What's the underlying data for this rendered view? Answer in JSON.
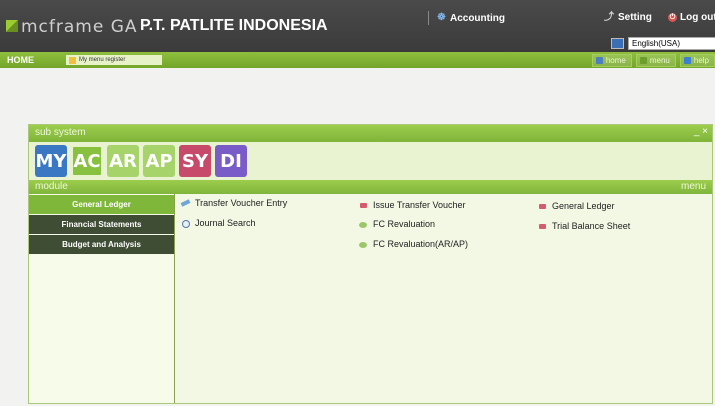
{
  "header": {
    "app_name": "mcframe GA",
    "company": "P.T. PATLITE INDONESIA",
    "accounting_label": "Accounting",
    "setting_label": "Setting",
    "logout_label": "Log out",
    "language": "English(USA)"
  },
  "navbar": {
    "home_label": "HOME",
    "menu_register_label": "My menu register",
    "buttons": [
      {
        "label": "home"
      },
      {
        "label": "menu"
      },
      {
        "label": "help"
      }
    ]
  },
  "subsystem": {
    "title": "sub system",
    "controls": "_ ×",
    "tiles": [
      "MY",
      "AC",
      "AR",
      "AP",
      "SY",
      "DI"
    ]
  },
  "module": {
    "title": "module",
    "menu_title": "menu",
    "items": [
      "General Ledger",
      "Financial Statements",
      "Budget and Analysis"
    ]
  },
  "menu": {
    "items": [
      {
        "label": "Transfer Voucher Entry"
      },
      {
        "label": "Journal Search"
      },
      {
        "label": "Issue Transfer Voucher"
      },
      {
        "label": "FC Revaluation"
      },
      {
        "label": "FC Revaluation(AR/AP)"
      },
      {
        "label": "General Ledger"
      },
      {
        "label": "Trial Balance Sheet"
      }
    ]
  },
  "colors": {
    "header_bg": "#3b3b3b",
    "accent_green": "#80b53c",
    "panel_bg": "#f3f8e4"
  }
}
